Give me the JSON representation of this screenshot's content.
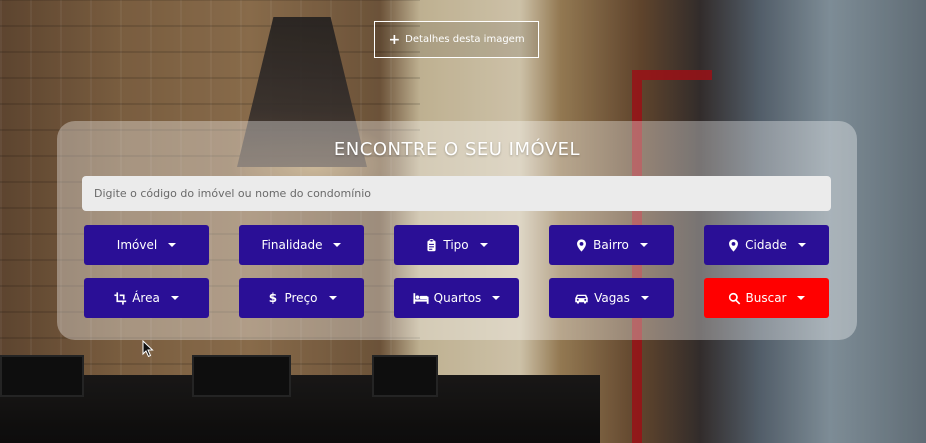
{
  "details_button": {
    "icon": "plus-icon",
    "label": "Detalhes desta imagem"
  },
  "panel": {
    "title": "ENCONTRE O SEU IMÓVEL",
    "search_placeholder": "Digite o código do imóvel ou nome do condomínio"
  },
  "filters": {
    "imovel": {
      "label": "Imóvel"
    },
    "finalidade": {
      "label": "Finalidade"
    },
    "tipo": {
      "label": "Tipo",
      "icon": "clipboard-icon"
    },
    "bairro": {
      "label": "Bairro",
      "icon": "map-marker-icon"
    },
    "cidade": {
      "label": "Cidade",
      "icon": "map-marker-icon"
    },
    "area": {
      "label": "Área",
      "icon": "crop-icon"
    },
    "preco": {
      "label": "Preço",
      "icon": "dollar-icon"
    },
    "quartos": {
      "label": "Quartos",
      "icon": "bed-icon"
    },
    "vagas": {
      "label": "Vagas",
      "icon": "car-icon"
    },
    "buscar": {
      "label": "Buscar",
      "icon": "search-icon"
    }
  },
  "colors": {
    "filter_bg": "#2a0f96",
    "search_bg": "#ff0000",
    "text": "#ffffff"
  }
}
